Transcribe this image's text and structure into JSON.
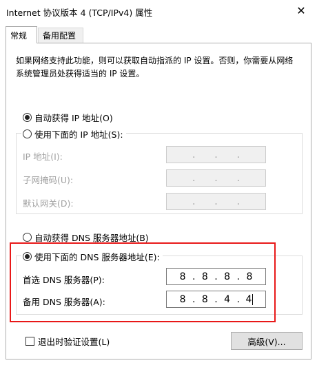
{
  "window": {
    "title": "Internet 协议版本 4 (TCP/IPv4) 属性",
    "close_glyph": "✕"
  },
  "tabs": [
    {
      "label": "常规",
      "active": true
    },
    {
      "label": "备用配置",
      "active": false
    }
  ],
  "description": "如果网络支持此功能，则可以获取自动指派的 IP 设置。否则，你需要从网络系统管理员处获得适当的 IP 设置。",
  "ip_section": {
    "auto_label": "自动获得 IP 地址(O)",
    "manual_label": "使用下面的 IP 地址(S):",
    "auto_selected": true,
    "fields": [
      {
        "label": "IP 地址(I):",
        "octets": [
          "",
          "",
          "",
          ""
        ]
      },
      {
        "label": "子网掩码(U):",
        "octets": [
          "",
          "",
          "",
          ""
        ]
      },
      {
        "label": "默认网关(D):",
        "octets": [
          "",
          "",
          "",
          ""
        ]
      }
    ]
  },
  "dns_section": {
    "auto_label": "自动获得 DNS 服务器地址(B)",
    "manual_label": "使用下面的 DNS 服务器地址(E):",
    "manual_selected": true,
    "preferred": {
      "label": "首选 DNS 服务器(P):",
      "octets": [
        "8",
        "8",
        "8",
        "8"
      ]
    },
    "alternate": {
      "label": "备用 DNS 服务器(A):",
      "octets": [
        "8",
        "8",
        "4",
        "4"
      ]
    }
  },
  "footer": {
    "validate_label": "退出时验证设置(L)",
    "validate_checked": false,
    "advanced_label": "高级(V)..."
  },
  "colors": {
    "highlight": "#e81818"
  }
}
